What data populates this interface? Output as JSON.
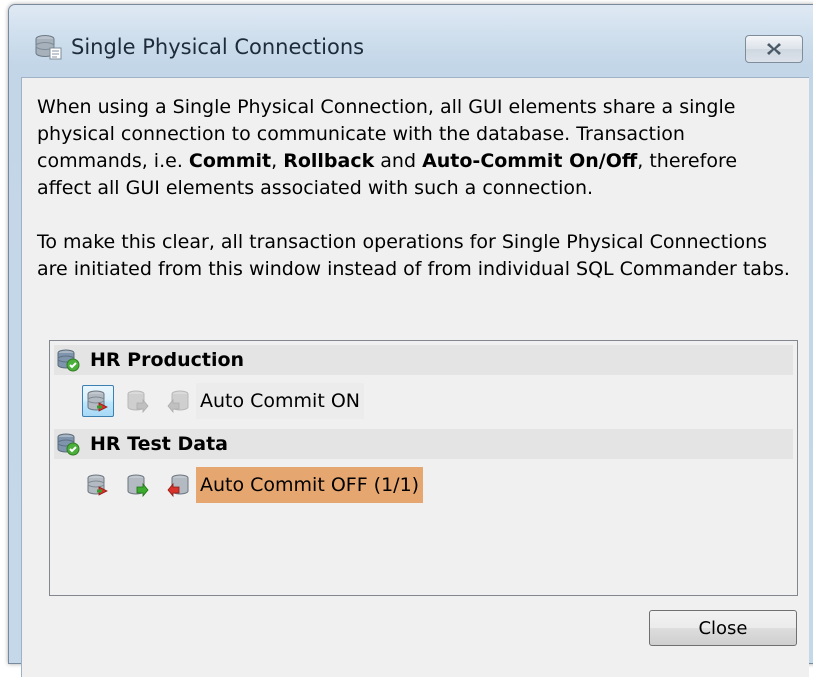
{
  "window": {
    "title": "Single Physical Connections",
    "close_glyph": "x-icon"
  },
  "description": {
    "p1_a": "When using a Single Physical Connection, all GUI elements share a single physical connection to communicate with the database. Transaction commands, i.e. ",
    "p1_commit": "Commit",
    "p1_sep1": ", ",
    "p1_rollback": "Rollback",
    "p1_sep2": " and ",
    "p1_autocommit": "Auto-Commit On/Off",
    "p1_b": ", therefore affect all GUI elements associated with such a connection.",
    "p2": "To make this clear, all transaction operations for Single Physical Connections are initiated from this window instead of from individual SQL Commander tabs."
  },
  "connections": [
    {
      "name": "HR Production",
      "icons": [
        "database-connected-icon"
      ],
      "actions": [
        {
          "icon": "toggle-autocommit-icon",
          "enabled": true,
          "focused": true
        },
        {
          "icon": "commit-icon",
          "enabled": false
        },
        {
          "icon": "rollback-icon",
          "enabled": false
        }
      ],
      "status": "Auto Commit ON",
      "highlight": false
    },
    {
      "name": "HR Test Data",
      "icons": [
        "database-connected-icon"
      ],
      "actions": [
        {
          "icon": "toggle-autocommit-icon",
          "enabled": true,
          "focused": false
        },
        {
          "icon": "commit-icon",
          "enabled": true
        },
        {
          "icon": "rollback-icon",
          "enabled": true
        }
      ],
      "status": "Auto Commit OFF (1/1)",
      "highlight": true,
      "highlight_color": "#e6a670"
    }
  ],
  "buttons": {
    "close": "Close"
  }
}
